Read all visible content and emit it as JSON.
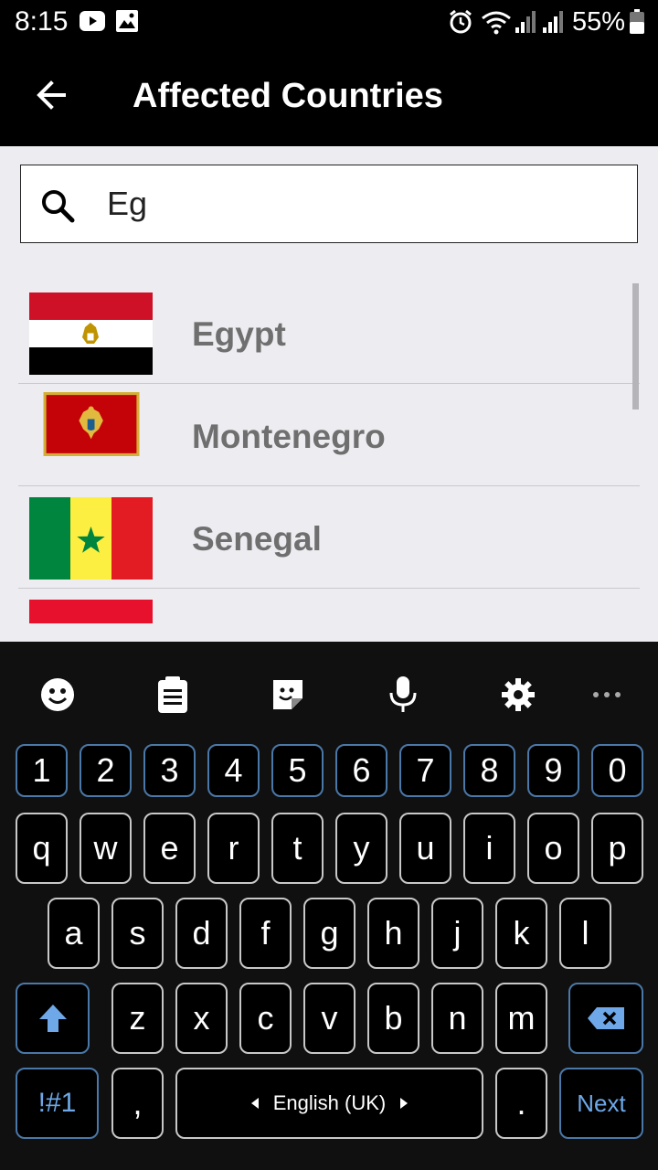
{
  "status_bar": {
    "time": "8:15",
    "battery": "55%",
    "icons": [
      "youtube-icon",
      "image-icon",
      "alarm-icon",
      "wifi-icon",
      "signal-icon",
      "signal-icon",
      "battery-icon"
    ]
  },
  "app_bar": {
    "title": "Affected Countries",
    "back_icon": "arrow-back-icon"
  },
  "search": {
    "value": "Eg",
    "icon": "search-icon"
  },
  "countries": [
    {
      "name": "Egypt",
      "flag": "egypt-flag"
    },
    {
      "name": "Montenegro",
      "flag": "montenegro-flag"
    },
    {
      "name": "Senegal",
      "flag": "senegal-flag"
    },
    {
      "name": "",
      "flag": "partial-flag"
    }
  ],
  "keyboard": {
    "toolbar": [
      "emoji-icon",
      "clipboard-icon",
      "sticker-icon",
      "mic-icon",
      "gear-icon",
      "more-icon"
    ],
    "numbers": [
      "1",
      "2",
      "3",
      "4",
      "5",
      "6",
      "7",
      "8",
      "9",
      "0"
    ],
    "row1": [
      "q",
      "w",
      "e",
      "r",
      "t",
      "y",
      "u",
      "i",
      "o",
      "p"
    ],
    "row2": [
      "a",
      "s",
      "d",
      "f",
      "g",
      "h",
      "j",
      "k",
      "l"
    ],
    "row3": [
      "z",
      "x",
      "c",
      "v",
      "b",
      "n",
      "m"
    ],
    "symbols_label": "!#1",
    "comma_label": ",",
    "space_label": "English (UK)",
    "period_label": ".",
    "next_label": "Next"
  },
  "colors": {
    "background_content": "#edecf1",
    "app_bar": "#000000",
    "key_accent": "#4a78a8",
    "next_text": "#6ea8e8"
  }
}
